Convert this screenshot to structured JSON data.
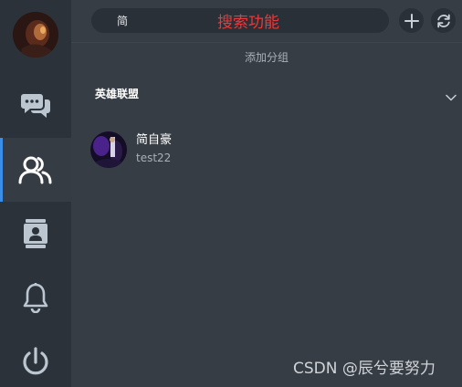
{
  "search": {
    "value": "简",
    "annotation": "搜索功能"
  },
  "sidebar": {
    "items": [
      {
        "icon": "chat-icon"
      },
      {
        "icon": "friends-icon",
        "active": true
      },
      {
        "icon": "contact-book-icon"
      },
      {
        "icon": "bell-icon"
      },
      {
        "icon": "power-icon"
      }
    ]
  },
  "toolbar": {
    "add_icon": "plus-icon",
    "refresh_icon": "refresh-icon"
  },
  "main": {
    "add_group_label": "添加分组",
    "group": {
      "name": "英雄联盟",
      "friends": [
        {
          "name": "简自豪",
          "sub": "test22"
        }
      ]
    }
  },
  "watermark": "CSDN @辰兮要努力",
  "colors": {
    "accent": "#3b8ee8",
    "annotation": "#e83a3a",
    "sidebar_bg": "#2c3239",
    "main_bg": "#363d45"
  }
}
